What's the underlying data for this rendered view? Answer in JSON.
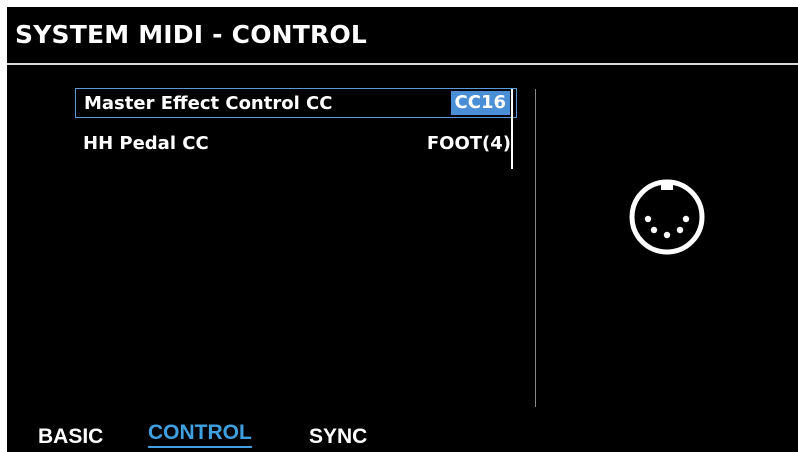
{
  "header": {
    "title": "SYSTEM MIDI - CONTROL"
  },
  "params": [
    {
      "name": "Master Effect Control CC",
      "value": "CC16",
      "selected": true
    },
    {
      "name": "HH Pedal CC",
      "value": "FOOT(4)",
      "selected": false
    }
  ],
  "icon": {
    "name": "midi-connector-icon"
  },
  "tabs": [
    {
      "label": "BASIC",
      "active": false
    },
    {
      "label": "CONTROL",
      "active": true
    },
    {
      "label": "SYNC",
      "active": false
    }
  ],
  "colors": {
    "accent": "#3fa0e0",
    "selection": "#4a8fd6",
    "background": "#000000"
  }
}
